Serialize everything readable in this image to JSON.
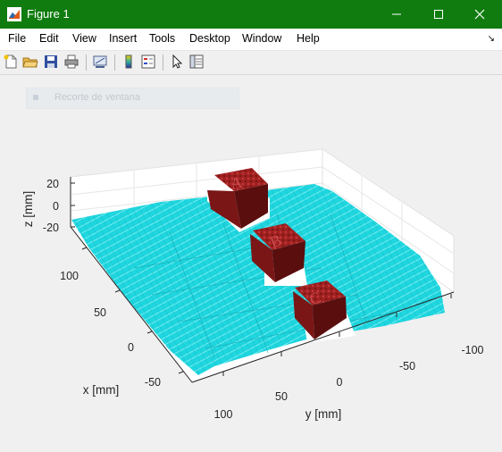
{
  "window": {
    "title": "Figure 1",
    "controls": [
      "minimize",
      "maximize",
      "close"
    ]
  },
  "menu": [
    "File",
    "Edit",
    "View",
    "Insert",
    "Tools",
    "Desktop",
    "Window",
    "Help"
  ],
  "toolbar": [
    "new-figure",
    "open-file",
    "save",
    "print",
    "link-plot",
    "colorbar",
    "legend",
    "edit-plot",
    "property-inspector"
  ],
  "ghost_overlay": {
    "label": "Recorte de ventana"
  },
  "plot": {
    "zlabel": "z [mm]",
    "xlabel": "x [mm]",
    "ylabel": "y [mm]",
    "z_ticks": [
      "20",
      "0",
      "-20"
    ],
    "x_ticks": [
      "100",
      "50",
      "0",
      "-50"
    ],
    "y_ticks": [
      "100",
      "50",
      "0",
      "-50",
      "-100"
    ],
    "surface_color": "#1fd6df",
    "block_color": "#8b1a1a"
  }
}
